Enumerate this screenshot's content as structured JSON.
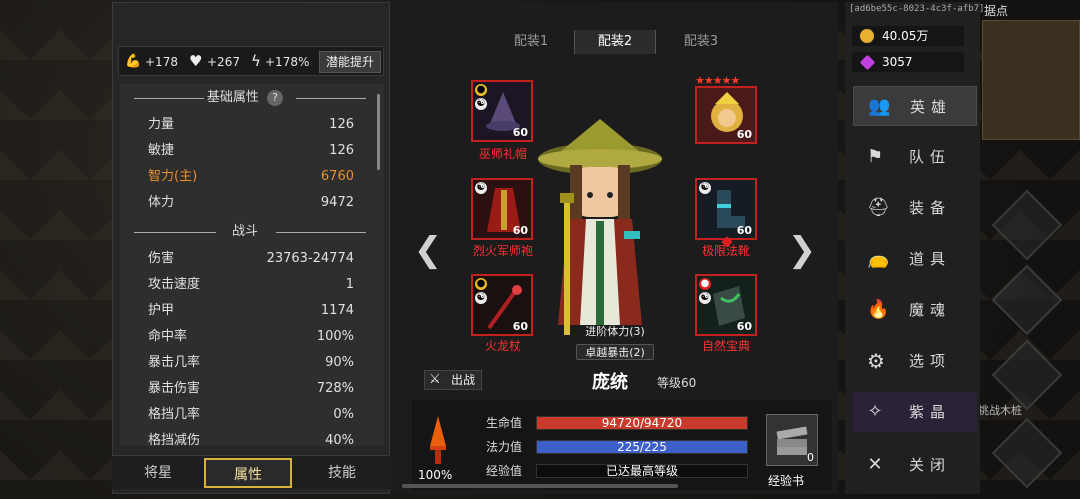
{
  "stat_bar": {
    "strength_bonus": "+178",
    "hp_bonus": "+267",
    "speed_bonus": "+178%",
    "potential_button": "潜能提升"
  },
  "attributes": {
    "basic_title": "基础属性",
    "basic": [
      {
        "k": "力量",
        "v": "126"
      },
      {
        "k": "敏捷",
        "v": "126"
      },
      {
        "k": "智力(主)",
        "v": "6760",
        "highlight": true
      },
      {
        "k": "体力",
        "v": "9472"
      }
    ],
    "combat_title": "战斗",
    "combat": [
      {
        "k": "伤害",
        "v": "23763-24774"
      },
      {
        "k": "攻击速度",
        "v": "1"
      },
      {
        "k": "护甲",
        "v": "1174"
      },
      {
        "k": "命中率",
        "v": "100%"
      },
      {
        "k": "暴击几率",
        "v": "90%"
      },
      {
        "k": "暴击伤害",
        "v": "728%"
      },
      {
        "k": "格挡几率",
        "v": "0%"
      },
      {
        "k": "格挡减伤",
        "v": "40%"
      }
    ]
  },
  "bottom_tabs": [
    "将星",
    "属性",
    "技能"
  ],
  "loadouts": [
    "配装1",
    "配装2",
    "配装3"
  ],
  "equipment": {
    "left": [
      {
        "name": "巫师礼帽",
        "level": "60"
      },
      {
        "name": "烈火军师袍",
        "level": "60"
      },
      {
        "name": "火龙杖",
        "level": "60"
      }
    ],
    "right": [
      {
        "name": "",
        "level": "60"
      },
      {
        "name": "极限法靴",
        "level": "60"
      },
      {
        "name": "自然宝典",
        "level": "60"
      }
    ]
  },
  "hero": {
    "tag1": "进阶体力(3)",
    "tag2": "卓越暴击(2)",
    "fight_label": "出战",
    "name": "庞统",
    "level": "等级60"
  },
  "bars": {
    "hp_label": "生命值",
    "hp_text": "94720/94720",
    "hp_fill": 1.0,
    "mp_label": "法力值",
    "mp_text": "225/225",
    "mp_fill": 1.0,
    "exp_label": "经验值",
    "exp_text": "已达最高等级",
    "percent": "100%",
    "book_label": "经验书",
    "book_count": "0"
  },
  "uid": "[ad6be55c-8023-4c3f-afb7]",
  "resources": {
    "gold": "40.05万",
    "gems": "3057"
  },
  "menu": [
    "英雄",
    "队伍",
    "装备",
    "道具",
    "魔魂",
    "选项",
    "紫晶",
    "关闭"
  ],
  "minimap_head": "据点",
  "side_label": "挑战木桩",
  "colors": {
    "hp": "#c83a2c",
    "mp": "#3c5fc8",
    "accent": "#d8b23a",
    "highlight": "#e8902a",
    "equip_name": "#ff3030"
  }
}
